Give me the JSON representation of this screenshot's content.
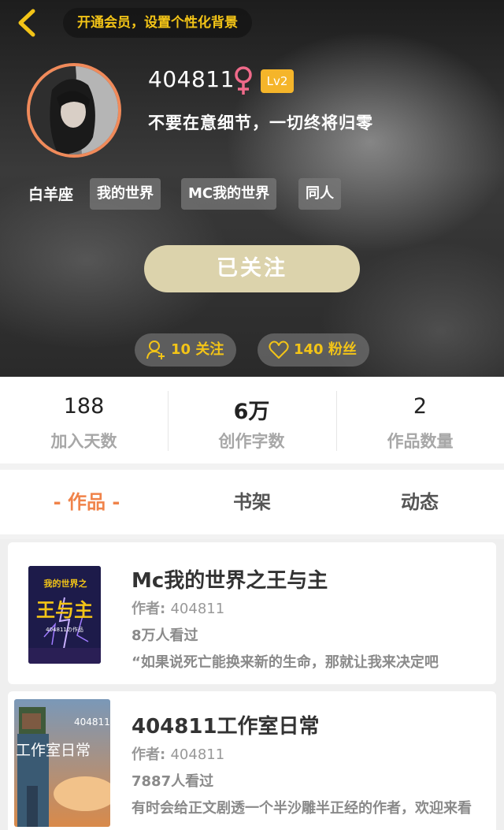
{
  "header": {
    "vip_banner": "开通会员，设置个性化背景",
    "username": "404811",
    "level": "Lv2",
    "signature": "不要在意细节，一切终将归零",
    "constellation": "白羊座",
    "tags": [
      "我的世界",
      "MC我的世界",
      "同人"
    ],
    "follow_button": "已关注",
    "following": "10 关注",
    "fans": "140 粉丝",
    "colors": {
      "accent": "#f3c417",
      "follow_btn": "#dcd3ac",
      "avatar_ring": "#f08a5a",
      "gender": "#f06a8a"
    }
  },
  "stats": [
    {
      "value": "188",
      "label": "加入天数"
    },
    {
      "value": "6万",
      "label": "创作字数"
    },
    {
      "value": "2",
      "label": "作品数量"
    }
  ],
  "tabs": [
    {
      "label": "- 作品 -",
      "active": true
    },
    {
      "label": "书架",
      "active": false
    },
    {
      "label": "动态",
      "active": false
    }
  ],
  "books": [
    {
      "title": "Mc我的世界之王与主",
      "author_label": "作者: ",
      "author": "404811",
      "views": "8万人看过",
      "desc": "“如果说死亡能换来新的生命，那就让我来决定吧",
      "cover_text": "我的世界之",
      "cover_big": "王与主",
      "cover_small": "404811の作品"
    },
    {
      "title": "404811工作室日常",
      "author_label": "作者: ",
      "author": "404811",
      "views": "7887人看过",
      "desc": "有时会给正文剧透一个半沙雕半正经的作者，欢迎来看",
      "cover_text": "工作室日常",
      "cover_small": "404811"
    }
  ]
}
